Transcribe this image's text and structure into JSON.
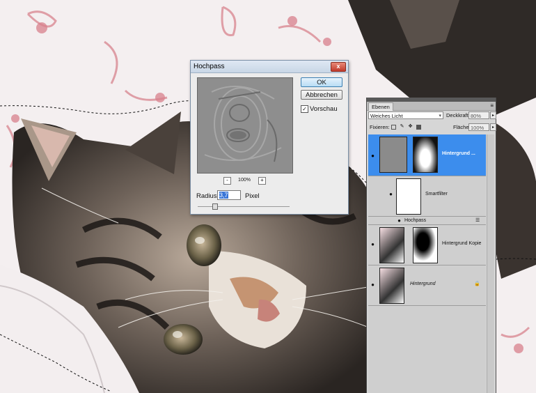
{
  "dialog": {
    "title": "Hochpass",
    "close_label": "x",
    "ok_label": "OK",
    "cancel_label": "Abbrechen",
    "preview_checked": "✓",
    "preview_label": "Vorschau",
    "zoom_minus": "-",
    "zoom_value": "100%",
    "zoom_plus": "+",
    "radius_label": "Radius:",
    "radius_value": "3,7",
    "radius_unit": "Pixel",
    "slider_fraction": 0.18
  },
  "layers_panel": {
    "tab_label": "Ebenen",
    "menu_icon": "≡",
    "blend_mode": "Weiches Licht",
    "opacity_label": "Deckkraft:",
    "opacity_value": "80%",
    "lock_label": "Fixieren:",
    "fill_label": "Fläche:",
    "fill_value": "100%",
    "layers": [
      {
        "name": "Hintergrund ...",
        "selected": true
      },
      {
        "name": "Smartfilter"
      },
      {
        "name": "Hochpass"
      },
      {
        "name": "Hintergrund Kopie"
      },
      {
        "name": "Hintergrund"
      }
    ]
  },
  "colors": {
    "selection": "#3c8ded",
    "panel_bg": "#d6d6d6",
    "dialog_bg": "#ececec"
  }
}
